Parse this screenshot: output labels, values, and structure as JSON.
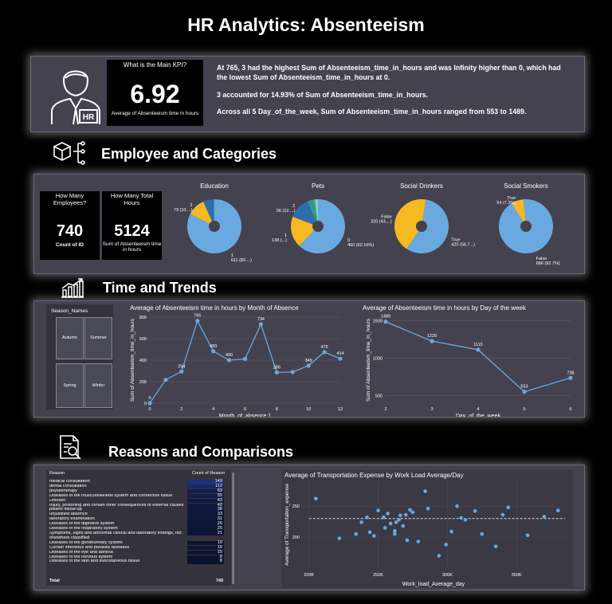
{
  "page_title": "HR Analytics: Absenteeism",
  "kpi": {
    "question": "What is the Main KPI?",
    "value": "6.92",
    "caption": "Average of Absenteeism time in hours",
    "hr_badge": "HR"
  },
  "insights": [
    "At 765, 3 had the highest Sum of Absenteeism_time_in_hours and was Infinity higher than 0, which had the lowest Sum of Absenteeism_time_in_hours at 0.",
    "3 accounted for 14.93% of Sum of Absenteeism_time_in_hours.",
    "Across all 5 Day_of_the_week, Sum of Absenteeism_time_in_hours ranged from 553 to 1489."
  ],
  "sections": {
    "employee": "Employee and Categories",
    "time": "Time and Trends",
    "reasons": "Reasons and Comparisons"
  },
  "employee_cards": [
    {
      "title": "How Many Employees?",
      "value": "740",
      "caption": "Count of ID"
    },
    {
      "title": "How Many Total Hours",
      "value": "5124",
      "caption": "Sum of Absenteeism time in hours"
    }
  ],
  "season_slicer": {
    "title": "Season_Names",
    "items": [
      "Autumn",
      "Summer",
      "Spring",
      "Winter"
    ]
  },
  "colors": {
    "blue": "#6aa9df",
    "yellow": "#f6b921",
    "darkblue": "#2f6cae",
    "green": "#2f9e86",
    "panel": "#44424f"
  },
  "chart_data": [
    {
      "type": "pie",
      "title": "Education",
      "slices": [
        {
          "label": "1",
          "value": 611,
          "text": "611 (82....)",
          "color": "#6aa9df"
        },
        {
          "label": "3",
          "value": 79,
          "text": "79 (10....)",
          "color": "#f6b921"
        },
        {
          "label": "2",
          "value": 46,
          "text": "",
          "color": "#2f6cae"
        },
        {
          "label": "4",
          "value": 4,
          "text": "",
          "color": "#2f9e86"
        }
      ]
    },
    {
      "type": "pie",
      "title": "Pets",
      "slices": [
        {
          "label": "0",
          "value": 460,
          "text": "460 (62.16%)",
          "color": "#6aa9df"
        },
        {
          "label": "1",
          "value": 138,
          "text": "138 (...)",
          "color": "#f6b921"
        },
        {
          "label": "2",
          "value": 96,
          "text": "96 (12....)",
          "color": "#2f6cae"
        },
        {
          "label": "4",
          "value": 32,
          "text": "",
          "color": "#2f9e86"
        },
        {
          "label": "5",
          "value": 14,
          "text": "",
          "color": "#8fd1c2"
        }
      ]
    },
    {
      "type": "pie",
      "title": "Social Drinkers",
      "slices": [
        {
          "label": "True",
          "value": 420,
          "text": "420 (56.7...)",
          "color": "#6aa9df"
        },
        {
          "label": "False",
          "value": 320,
          "text": "320 (43....)",
          "color": "#f6b921"
        }
      ]
    },
    {
      "type": "pie",
      "title": "Social Smokers",
      "slices": [
        {
          "label": "False",
          "value": 686,
          "text": "686 (92.7%)",
          "color": "#6aa9df"
        },
        {
          "label": "True",
          "value": 54,
          "text": "54 (7.3%)",
          "color": "#f6b921"
        }
      ]
    },
    {
      "type": "line",
      "title": "Average of Absenteeism time in hours by Month of Absence",
      "xlabel": "Month_of_absence.1",
      "ylabel": "Sum of Absenteeism_time_in_hours",
      "x": [
        0,
        1,
        2,
        3,
        4,
        5,
        6,
        7,
        8,
        9,
        10,
        11,
        12
      ],
      "y": [
        0,
        218,
        294,
        765,
        483,
        400,
        411,
        734,
        286,
        290,
        349,
        475,
        414
      ],
      "point_labels": [
        "0",
        "",
        "294",
        "765",
        "483",
        "400",
        "",
        "734",
        "286",
        "",
        "349",
        "475",
        "414"
      ],
      "xticks": [
        0,
        2,
        4,
        6,
        8,
        10,
        12
      ],
      "yticks": [
        0,
        200,
        400,
        600,
        800
      ],
      "ylim": [
        0,
        800
      ]
    },
    {
      "type": "line",
      "title": "Average of Absenteeism time in hours by Day of the week",
      "xlabel": "Day_of_the_week",
      "ylabel": "Sum of Absenteeism_time_in_hours",
      "x": [
        2,
        3,
        4,
        5,
        6
      ],
      "y": [
        1489,
        1229,
        1115,
        553,
        738
      ],
      "point_labels": [
        "1489",
        "1229",
        "1115",
        "553",
        "738"
      ],
      "xticks": [
        2,
        3,
        4,
        5,
        6
      ],
      "yticks": [
        500,
        1000,
        1500
      ],
      "ylim": [
        400,
        1550
      ]
    },
    {
      "type": "table",
      "headers": [
        "Reason",
        "Count of Reason"
      ],
      "rows": [
        [
          "medical consultation",
          "149"
        ],
        [
          "dental consultation",
          "112"
        ],
        [
          "physiotherapy",
          "69"
        ],
        [
          "Diseases of the musculoskeletal system and connective tissue",
          "55"
        ],
        [
          "Unkown",
          "43"
        ],
        [
          "Injury, poisoning and certain other consequences of external causes",
          "40"
        ],
        [
          "patient follow-up",
          "38"
        ],
        [
          "unjustified absence",
          "33"
        ],
        [
          "laboratory examination",
          "31"
        ],
        [
          "Diseases of the digestive system",
          "26"
        ],
        [
          "Diseases of the respiratory system",
          "25"
        ],
        [
          "Symptoms, signs and abnormal clinical and laboratory findings, not elsewhere classified",
          "21"
        ],
        [
          "Diseases of the genitourinary system",
          "19"
        ],
        [
          "Certain infectious and parasitic diseases",
          "16"
        ],
        [
          "Diseases of the eye and adnexa",
          "15"
        ],
        [
          "Diseases of the nervous system",
          "8"
        ],
        [
          "Diseases of the skin and subcutaneous tissue",
          "8"
        ]
      ],
      "total_label": "Total",
      "total_value": "740"
    },
    {
      "type": "scatter",
      "title": "Average of Transportation Expense by Work Load Average/Day",
      "xlabel": "Work_load_Average_day",
      "ylabel": "Average of Transportation_expense",
      "xticks": [
        200,
        250,
        300,
        350
      ],
      "xtick_labels": [
        "200K",
        "250K",
        "300K",
        "350K"
      ],
      "yticks": [
        200,
        250
      ],
      "xlim": [
        195,
        385
      ],
      "ylim": [
        150,
        290
      ],
      "trend": 230,
      "points": [
        [
          205,
          262
        ],
        [
          222,
          198
        ],
        [
          234,
          205
        ],
        [
          238,
          224
        ],
        [
          242,
          232
        ],
        [
          244,
          208
        ],
        [
          247,
          202
        ],
        [
          250,
          243
        ],
        [
          254,
          232
        ],
        [
          255,
          215
        ],
        [
          257,
          238
        ],
        [
          259,
          222
        ],
        [
          262,
          210
        ],
        [
          263,
          224
        ],
        [
          265,
          228
        ],
        [
          266,
          235
        ],
        [
          268,
          218
        ],
        [
          270,
          236
        ],
        [
          271,
          195
        ],
        [
          273,
          244
        ],
        [
          275,
          240
        ],
        [
          279,
          193
        ],
        [
          284,
          274
        ],
        [
          286,
          246
        ],
        [
          294,
          170
        ],
        [
          299,
          188
        ],
        [
          303,
          209
        ],
        [
          307,
          250
        ],
        [
          310,
          231
        ],
        [
          313,
          228
        ],
        [
          320,
          242
        ],
        [
          325,
          205
        ],
        [
          335,
          185
        ],
        [
          340,
          236
        ],
        [
          344,
          248
        ],
        [
          358,
          203
        ],
        [
          370,
          233
        ],
        [
          380,
          243
        ],
        [
          262,
          205
        ]
      ]
    }
  ]
}
